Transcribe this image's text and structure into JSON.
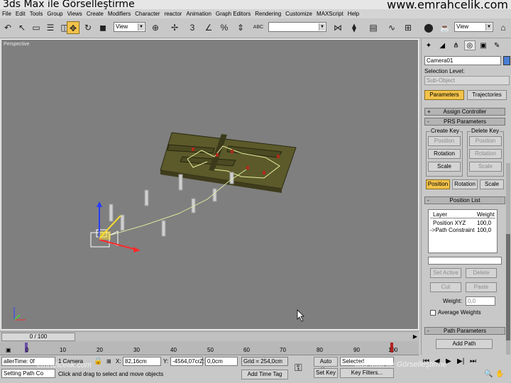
{
  "title": {
    "left": "3ds Max ile Görselleştirme",
    "right": "www.emrahcelik.com"
  },
  "menu": [
    "File",
    "Edit",
    "Tools",
    "Group",
    "Views",
    "Create",
    "Modifiers",
    "Character",
    "reactor",
    "Animation",
    "Graph Editors",
    "Rendering",
    "Customize",
    "MAXScript",
    "Help"
  ],
  "toolbar": {
    "ref_coord": "View",
    "selection_set": "",
    "view2": "View"
  },
  "toolbar_icons": {
    "undo": "↶",
    "select": "↖",
    "select_region": "▭",
    "select_by_name": "☰",
    "window": "◫",
    "move": "✥",
    "rotate": "↻",
    "scale": "◼",
    "snap3": "3",
    "angle_snap": "∠",
    "percent_snap": "%",
    "spinner_snap": "⇕",
    "abc": "ABC",
    "mirror": "⋈",
    "align": "⧫",
    "layers": "▤",
    "curve": "∿",
    "schematic": "⊞",
    "material": "⬤",
    "render_setup": "⌂",
    "quick_render": "☕"
  },
  "viewport": {
    "label": "Perspective"
  },
  "timeslider": {
    "position": "0 / 100"
  },
  "trackbar": {
    "ticks": [
      "0",
      "10",
      "20",
      "30",
      "40",
      "50",
      "60",
      "70",
      "80",
      "90",
      "100"
    ]
  },
  "status": {
    "listener": "allerTime: 0f",
    "prompt_line1": "Setting Path Co",
    "prompt_line2": "Click and drag to select and move objects",
    "selected_label": "1 Camera",
    "x_label": "X:",
    "x_val": "82,16cm",
    "y_label": "Y:",
    "y_val": "-4564,07cr",
    "z_label": "Z:",
    "z_val": "0,0cm",
    "grid": "Grid = 254,0cm",
    "add_time_tag": "Add Time Tag",
    "auto_key": "Auto Key",
    "set_key": "Set Key",
    "selected_dropdown": "Selected",
    "key_filters": "Key Filters..."
  },
  "cmd": {
    "object_name": "Camera01",
    "selection_level": "Selection Level:",
    "sub_object": "Sub-Object",
    "parameters": "Parameters",
    "trajectories": "Trajectories",
    "assign_controller": "Assign Controller",
    "prs_parameters": "PRS Parameters",
    "create_key": "Create Key",
    "delete_key": "Delete Key",
    "position": "Position",
    "rotation": "Rotation",
    "scale": "Scale",
    "position_list": "Position List",
    "layer_header": "Layer",
    "weight_header": "Weight",
    "layers": [
      {
        "name": "Position XYZ",
        "weight": "100,0"
      },
      {
        "name": "->Path Constraint",
        "weight": "100,0"
      }
    ],
    "set_active": "Set Active",
    "delete": "Delete",
    "cut": "Cut",
    "paste": "Paste",
    "weight_label": "Weight:",
    "weight_value": "0,0",
    "average_weights": "Average Weights",
    "path_parameters": "Path Parameters",
    "add_path": "Add Path",
    "plus": "+",
    "minus": "-"
  },
  "watermarks": {
    "left": "emrahcelik.com",
    "right": "3ds Max ile Görselleştirme"
  },
  "colors": {
    "viewport_bg": "#7f7f7f",
    "active_yellow": "#f2c24a",
    "object_color": "#4a7fd4"
  }
}
